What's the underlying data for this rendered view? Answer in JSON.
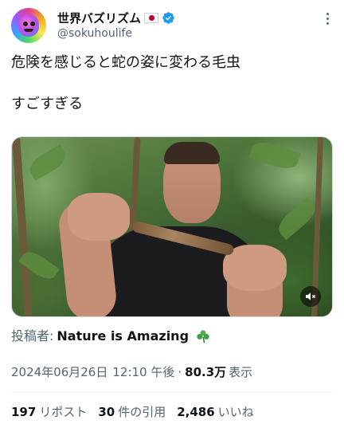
{
  "author": {
    "display_name": "世界バズリズム",
    "flag_icon": "japan-flag-icon",
    "verified_icon": "verified-badge-icon",
    "verified_color": "#1d9bf0",
    "handle": "@sokuhoulife"
  },
  "tweet": {
    "line1": "危険を感じると蛇の姿に変わる毛虫",
    "line2": "すごすぎる"
  },
  "media": {
    "description_icon": "mute-icon"
  },
  "source": {
    "label": "投稿者:",
    "name": "Nature is Amazing",
    "emoji_icon": "shamrock-icon"
  },
  "meta": {
    "date": "2024年06月26日",
    "time": "12:10 午後",
    "separator": "·",
    "views_count": "80.3万",
    "views_label": "表示"
  },
  "stats": {
    "reposts_count": "197",
    "reposts_label": "リポスト",
    "quotes_count": "30",
    "quotes_label": "件の引用",
    "likes_count": "2,486",
    "likes_label": "いいね"
  }
}
